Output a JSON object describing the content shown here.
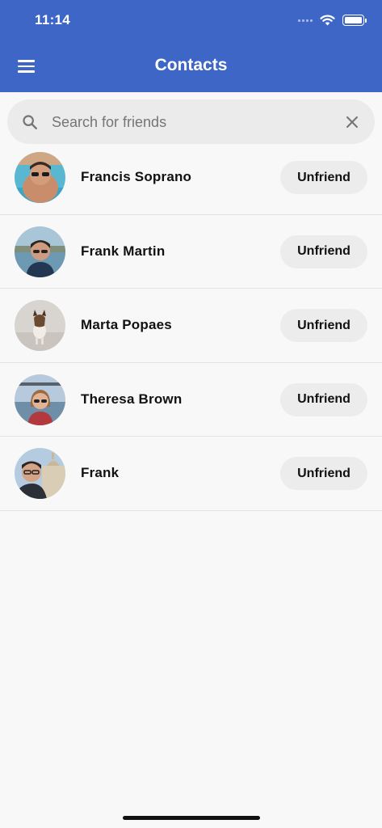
{
  "status_bar": {
    "time": "11:14"
  },
  "app_bar": {
    "title": "Contacts",
    "menu_icon": "menu-icon"
  },
  "search": {
    "placeholder": "Search for friends",
    "value": ""
  },
  "contacts": [
    {
      "name": "Francis Soprano",
      "action_label": "Unfriend"
    },
    {
      "name": "Frank Martin",
      "action_label": "Unfriend"
    },
    {
      "name": "Marta Popaes",
      "action_label": "Unfriend"
    },
    {
      "name": "Theresa Brown",
      "action_label": "Unfriend"
    },
    {
      "name": "Frank",
      "action_label": "Unfriend"
    }
  ],
  "colors": {
    "app_bar": "#3d66c7",
    "background": "#f8f8f8",
    "button": "#ececec"
  }
}
